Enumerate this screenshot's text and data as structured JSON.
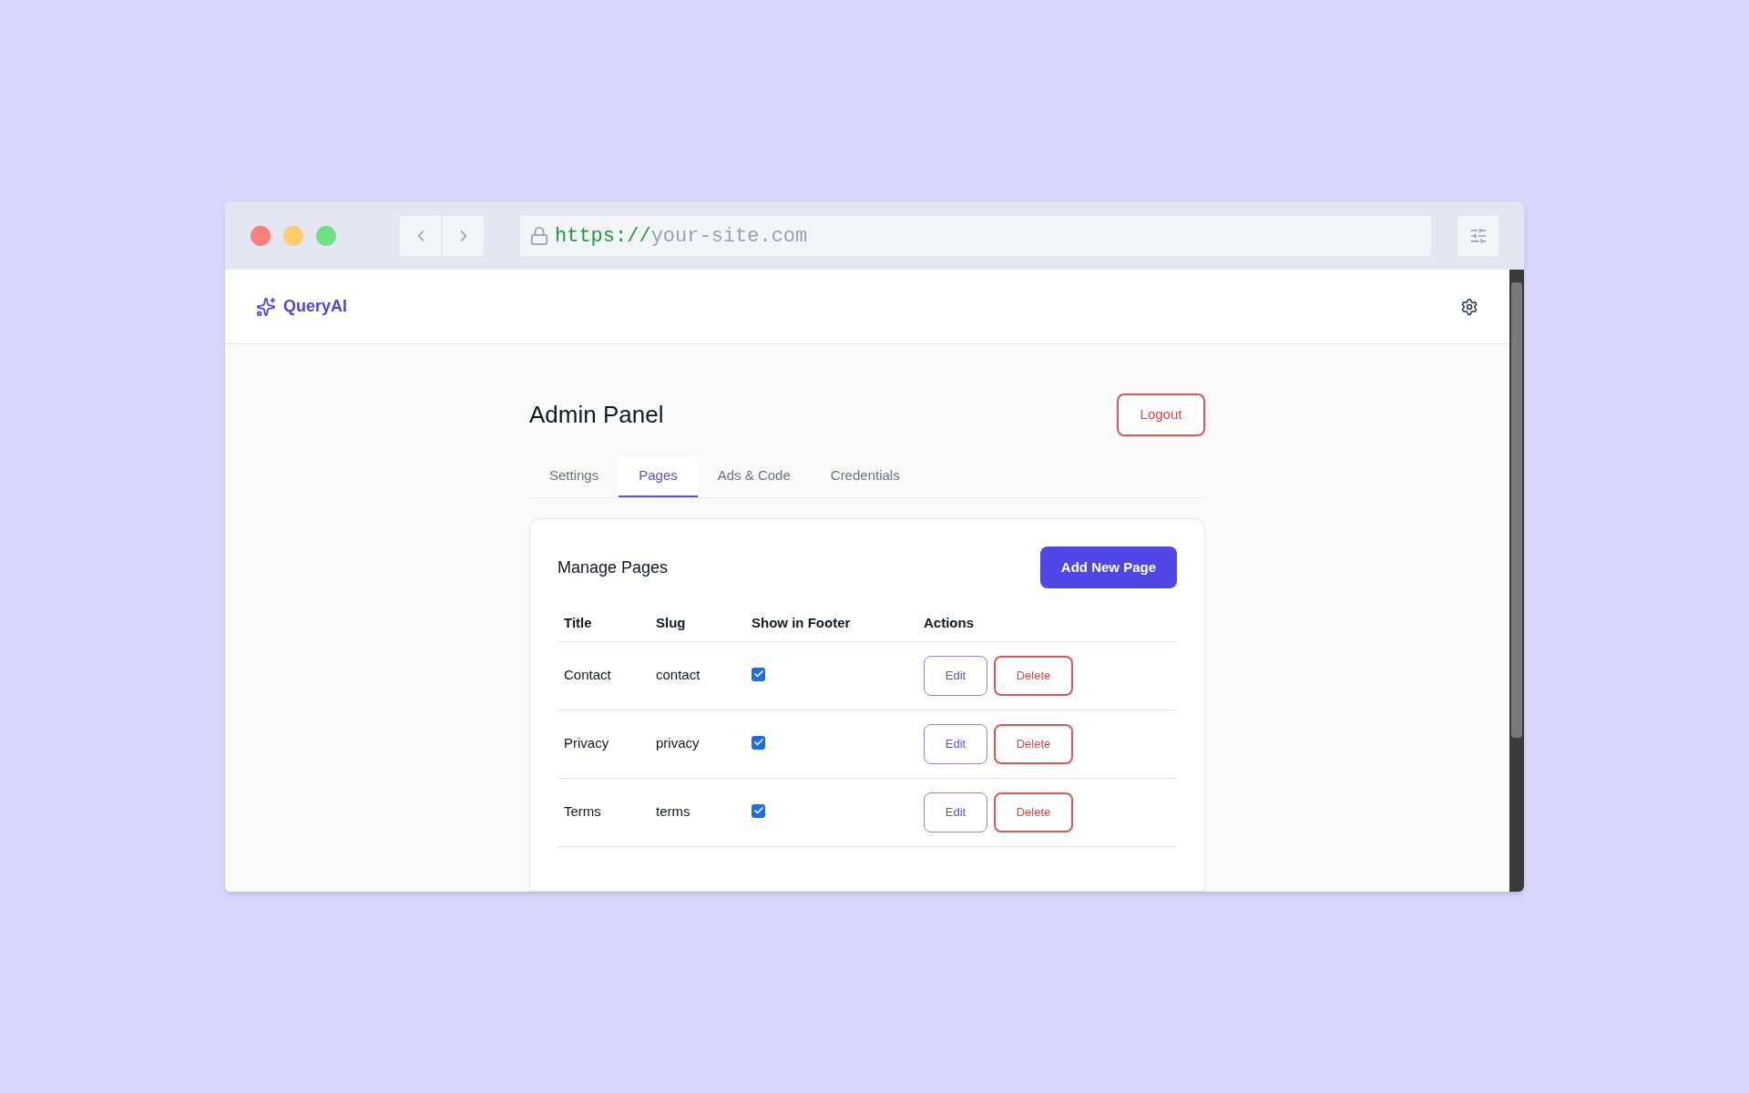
{
  "browser": {
    "url_scheme": "https://",
    "url_host": "your-site.com"
  },
  "header": {
    "brand": "QueryAI"
  },
  "page": {
    "title": "Admin Panel",
    "logout": "Logout"
  },
  "tabs": [
    {
      "label": "Settings",
      "selected": false
    },
    {
      "label": "Pages",
      "selected": true
    },
    {
      "label": "Ads & Code",
      "selected": false
    },
    {
      "label": "Credentials",
      "selected": false
    }
  ],
  "card": {
    "title": "Manage Pages",
    "add_button": "Add New Page"
  },
  "table": {
    "columns": [
      "Title",
      "Slug",
      "Show in Footer",
      "Actions"
    ],
    "rows": [
      {
        "title": "Contact",
        "slug": "contact",
        "show_in_footer": true,
        "edit": "Edit",
        "delete": "Delete"
      },
      {
        "title": "Privacy",
        "slug": "privacy",
        "show_in_footer": true,
        "edit": "Edit",
        "delete": "Delete"
      },
      {
        "title": "Terms",
        "slug": "terms",
        "show_in_footer": true,
        "edit": "Edit",
        "delete": "Delete"
      }
    ]
  }
}
